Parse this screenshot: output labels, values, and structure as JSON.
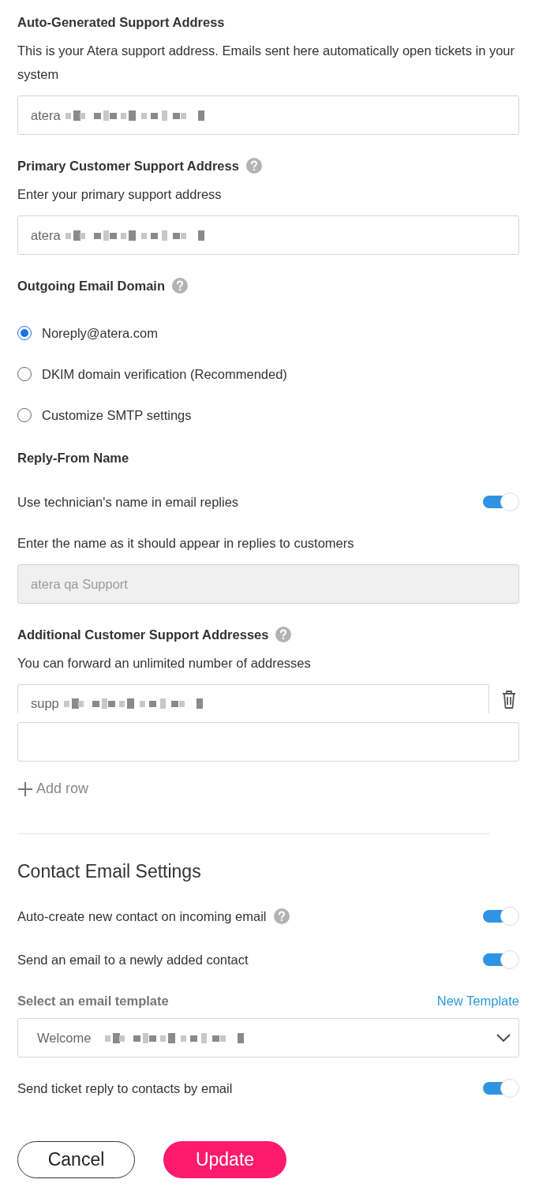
{
  "items": [
    {
      "kind": "heading",
      "text": "Auto-Generated Support Address"
    },
    {
      "kind": "description",
      "text": "This is your Atera support address. Emails sent here automatically open tickets in your system"
    },
    {
      "kind": "field",
      "value": "atera",
      "redacted": true
    },
    {
      "kind": "heading",
      "text": "Primary Customer Support Address",
      "help": true
    },
    {
      "kind": "description",
      "text": "Enter your primary support address"
    },
    {
      "kind": "field",
      "value": "atera",
      "redacted": true
    },
    {
      "kind": "heading",
      "text": "Outgoing Email Domain",
      "help": true
    },
    {
      "kind": "radio",
      "label": "Noreply@atera.com",
      "selected": true
    },
    {
      "kind": "radio",
      "label": "DKIM domain verification (Recommended)",
      "selected": false
    },
    {
      "kind": "radio",
      "label": "Customize SMTP settings",
      "selected": false
    },
    {
      "kind": "heading",
      "text": "Reply-From Name"
    },
    {
      "kind": "toggle",
      "label": "Use technician's name in email replies",
      "on": true
    },
    {
      "kind": "description",
      "text": "Enter the name as it should appear in replies to customers"
    },
    {
      "kind": "field",
      "placeholder": "atera qa Support",
      "disabled": true
    },
    {
      "kind": "heading",
      "text": "Additional Customer Support Addresses",
      "help": true
    },
    {
      "kind": "description",
      "text": "You can forward an unlimited number of addresses"
    },
    {
      "kind": "field",
      "value": "supp",
      "removable": true,
      "redacted": true
    },
    {
      "kind": "field"
    },
    {
      "kind": "add_row",
      "text": "Add row"
    },
    {
      "kind": "divider"
    },
    {
      "kind": "section_title",
      "text": "Contact Email Settings"
    },
    {
      "kind": "toggle",
      "label": "Auto-create new contact on incoming email",
      "on": true,
      "help": true
    },
    {
      "kind": "toggle",
      "label": "Send an email to a newly added contact",
      "on": true
    },
    {
      "kind": "select_label",
      "text": "Select an email template",
      "link": "New Template"
    },
    {
      "kind": "select",
      "value": "Welcome",
      "redacted": true
    },
    {
      "kind": "toggle",
      "label": "Send ticket reply to contacts by email",
      "on": true
    }
  ],
  "buttons": [
    {
      "label": "Cancel",
      "kind": "secondary"
    },
    {
      "label": "Update",
      "kind": "primary"
    }
  ]
}
